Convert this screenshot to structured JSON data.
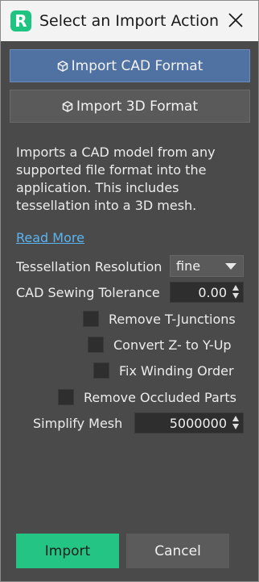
{
  "window": {
    "title": "Select an Import Action",
    "logo_text": "R",
    "accent": "#1ec47f"
  },
  "actions": {
    "import_cad_label": "Import CAD Format",
    "import_3d_label": "Import 3D Format",
    "icon": "cube-icon"
  },
  "description": {
    "text": "Imports a CAD model from any supported file format into the application. This includes tessellation into a 3D mesh.",
    "read_more": "Read More"
  },
  "settings": {
    "tessellation_label": "Tessellation Resolution",
    "tessellation_value": "fine",
    "sewing_label": "CAD Sewing Tolerance",
    "sewing_value": "0.00",
    "remove_tjunctions_label": "Remove T-Junctions",
    "remove_tjunctions_checked": false,
    "convert_zup_label": "Convert Z- to Y-Up",
    "convert_zup_checked": false,
    "fix_winding_label": "Fix Winding Order",
    "fix_winding_checked": false,
    "remove_occluded_label": "Remove Occluded Parts",
    "remove_occluded_checked": false,
    "simplify_label": "Simplify Mesh",
    "simplify_value": "5000000"
  },
  "footer": {
    "import_label": "Import",
    "cancel_label": "Cancel"
  }
}
